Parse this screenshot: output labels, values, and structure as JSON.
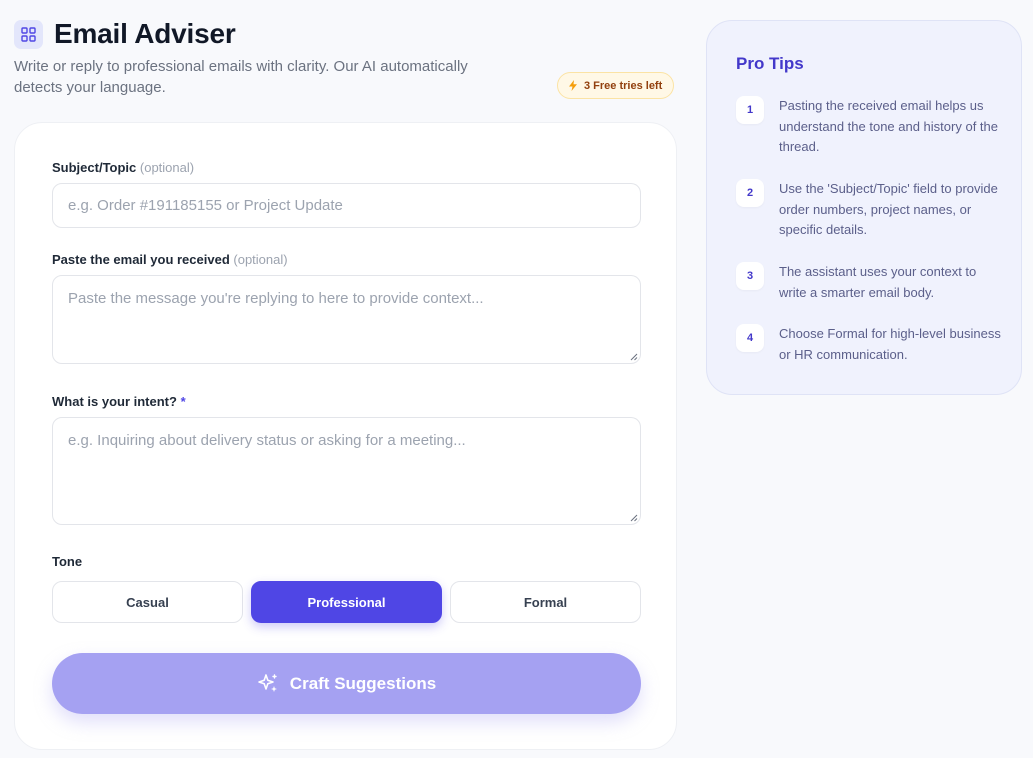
{
  "header": {
    "title": "Email Adviser",
    "subtitle": "Write or reply to professional emails with clarity. Our AI automatically detects your language.",
    "icon": "grid-icon",
    "tries_badge": "3 Free tries left"
  },
  "form": {
    "subject": {
      "label": "Subject/Topic",
      "optional": "(optional)",
      "placeholder": "e.g. Order #191185155 or Project Update",
      "value": ""
    },
    "received": {
      "label": "Paste the email you received",
      "optional": "(optional)",
      "placeholder": "Paste the message you're replying to here to provide context...",
      "value": ""
    },
    "intent": {
      "label": "What is your intent?",
      "required_mark": "*",
      "placeholder": "e.g. Inquiring about delivery status or asking for a meeting...",
      "value": ""
    },
    "tone": {
      "label": "Tone",
      "options": [
        "Casual",
        "Professional",
        "Formal"
      ],
      "selected": "Professional"
    },
    "submit_label": "Craft Suggestions"
  },
  "tips": {
    "title": "Pro Tips",
    "items": [
      {
        "num": "1",
        "text": "Pasting the received email helps us understand the tone and history of the thread."
      },
      {
        "num": "2",
        "text": "Use the 'Subject/Topic' field to provide order numbers, project names, or specific details."
      },
      {
        "num": "3",
        "text": "The assistant uses your context to write a smarter email body."
      },
      {
        "num": "4",
        "text": "Choose Formal for high-level business or HR communication."
      }
    ]
  },
  "colors": {
    "accent": "#4f46e5",
    "accent_light": "#a5a1f2",
    "tips_bg": "#f0f2fd",
    "badge_bg": "#fff8e6"
  }
}
